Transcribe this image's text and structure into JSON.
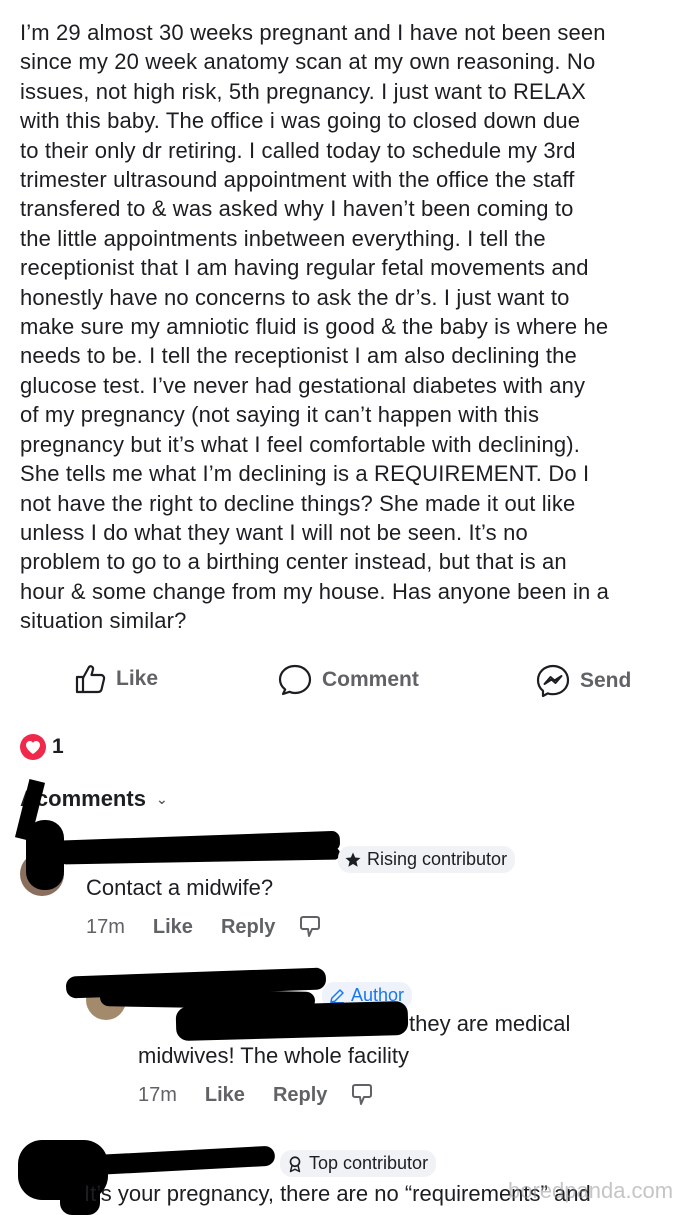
{
  "post": {
    "body": "I’m 29 almost 30 weeks pregnant and I have not been seen\nsince my 20 week anatomy scan at my own reasoning. No\nissues, not high risk, 5th pregnancy. I just want to RELAX\nwith this baby. The office i was going to closed down due\nto their only dr retiring. I called today to schedule my 3rd\ntrimester ultrasound appointment with the office the staff\ntransfered to & was asked why I haven’t been coming to\nthe little appointments inbetween everything. I tell the\nreceptionist that I am having regular fetal movements and\nhonestly have no concerns to ask the dr’s. I just want to\nmake sure my amniotic fluid is good & the baby is where he\nneeds to be. I tell the receptionist I am also declining the\nglucose test. I’ve never had gestational diabetes with any\nof my pregnancy (not saying it can’t happen with this\npregnancy but it’s what I feel comfortable with declining).\nShe tells me what I’m declining is a REQUIREMENT. Do I\nnot have the right to decline things? She made it out like\nunless I do what they want I will not be seen. It’s no\nproblem to go to a birthing center instead, but that is an\nhour & some change from my house. Has anyone been in a\nsituation similar?"
  },
  "actions": {
    "like": "Like",
    "comment": "Comment",
    "send": "Send"
  },
  "reactions": {
    "count": "1"
  },
  "comments_header": {
    "label": "comments",
    "prefix": "A"
  },
  "comments": [
    {
      "badge": "Rising contributor",
      "text": "Contact a midwife?",
      "time": "17m",
      "like": "Like",
      "reply": "Reply"
    },
    {
      "badge": "Author",
      "line1": "they are medical",
      "line2": "midwives! The whole facility",
      "time": "17m",
      "like": "Like",
      "reply": "Reply"
    },
    {
      "badge": "Top contributor",
      "text": "It’s your pregnancy, there are no “requirements” and"
    }
  ],
  "watermark": "boredpanda.com",
  "colors": {
    "accent": "#1877f2",
    "heart": "#f0284a",
    "muted": "#606266"
  }
}
